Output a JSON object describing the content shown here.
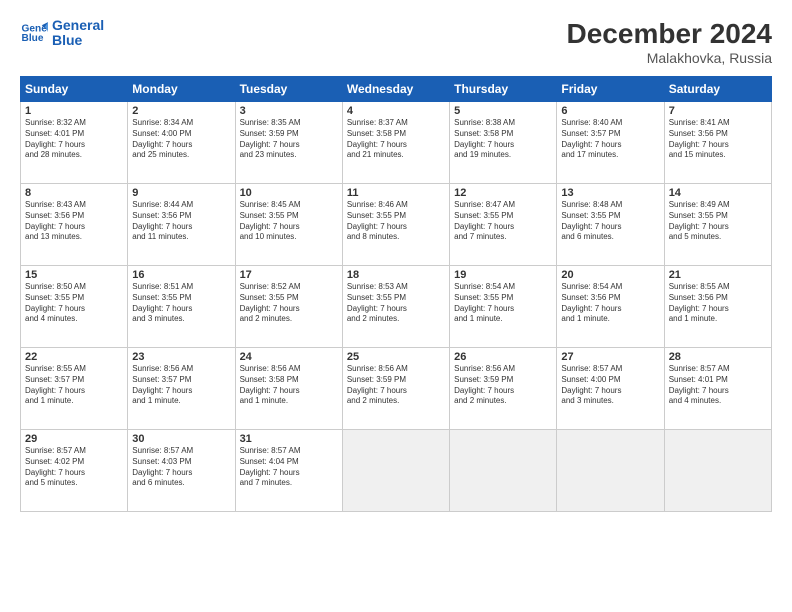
{
  "logo": {
    "line1": "General",
    "line2": "Blue"
  },
  "title": "December 2024",
  "subtitle": "Malakhovka, Russia",
  "days_of_week": [
    "Sunday",
    "Monday",
    "Tuesday",
    "Wednesday",
    "Thursday",
    "Friday",
    "Saturday"
  ],
  "weeks": [
    [
      {
        "day": "1",
        "info": "Sunrise: 8:32 AM\nSunset: 4:01 PM\nDaylight: 7 hours\nand 28 minutes."
      },
      {
        "day": "2",
        "info": "Sunrise: 8:34 AM\nSunset: 4:00 PM\nDaylight: 7 hours\nand 25 minutes."
      },
      {
        "day": "3",
        "info": "Sunrise: 8:35 AM\nSunset: 3:59 PM\nDaylight: 7 hours\nand 23 minutes."
      },
      {
        "day": "4",
        "info": "Sunrise: 8:37 AM\nSunset: 3:58 PM\nDaylight: 7 hours\nand 21 minutes."
      },
      {
        "day": "5",
        "info": "Sunrise: 8:38 AM\nSunset: 3:58 PM\nDaylight: 7 hours\nand 19 minutes."
      },
      {
        "day": "6",
        "info": "Sunrise: 8:40 AM\nSunset: 3:57 PM\nDaylight: 7 hours\nand 17 minutes."
      },
      {
        "day": "7",
        "info": "Sunrise: 8:41 AM\nSunset: 3:56 PM\nDaylight: 7 hours\nand 15 minutes."
      }
    ],
    [
      {
        "day": "8",
        "info": "Sunrise: 8:43 AM\nSunset: 3:56 PM\nDaylight: 7 hours\nand 13 minutes."
      },
      {
        "day": "9",
        "info": "Sunrise: 8:44 AM\nSunset: 3:56 PM\nDaylight: 7 hours\nand 11 minutes."
      },
      {
        "day": "10",
        "info": "Sunrise: 8:45 AM\nSunset: 3:55 PM\nDaylight: 7 hours\nand 10 minutes."
      },
      {
        "day": "11",
        "info": "Sunrise: 8:46 AM\nSunset: 3:55 PM\nDaylight: 7 hours\nand 8 minutes."
      },
      {
        "day": "12",
        "info": "Sunrise: 8:47 AM\nSunset: 3:55 PM\nDaylight: 7 hours\nand 7 minutes."
      },
      {
        "day": "13",
        "info": "Sunrise: 8:48 AM\nSunset: 3:55 PM\nDaylight: 7 hours\nand 6 minutes."
      },
      {
        "day": "14",
        "info": "Sunrise: 8:49 AM\nSunset: 3:55 PM\nDaylight: 7 hours\nand 5 minutes."
      }
    ],
    [
      {
        "day": "15",
        "info": "Sunrise: 8:50 AM\nSunset: 3:55 PM\nDaylight: 7 hours\nand 4 minutes."
      },
      {
        "day": "16",
        "info": "Sunrise: 8:51 AM\nSunset: 3:55 PM\nDaylight: 7 hours\nand 3 minutes."
      },
      {
        "day": "17",
        "info": "Sunrise: 8:52 AM\nSunset: 3:55 PM\nDaylight: 7 hours\nand 2 minutes."
      },
      {
        "day": "18",
        "info": "Sunrise: 8:53 AM\nSunset: 3:55 PM\nDaylight: 7 hours\nand 2 minutes."
      },
      {
        "day": "19",
        "info": "Sunrise: 8:54 AM\nSunset: 3:55 PM\nDaylight: 7 hours\nand 1 minute."
      },
      {
        "day": "20",
        "info": "Sunrise: 8:54 AM\nSunset: 3:56 PM\nDaylight: 7 hours\nand 1 minute."
      },
      {
        "day": "21",
        "info": "Sunrise: 8:55 AM\nSunset: 3:56 PM\nDaylight: 7 hours\nand 1 minute."
      }
    ],
    [
      {
        "day": "22",
        "info": "Sunrise: 8:55 AM\nSunset: 3:57 PM\nDaylight: 7 hours\nand 1 minute."
      },
      {
        "day": "23",
        "info": "Sunrise: 8:56 AM\nSunset: 3:57 PM\nDaylight: 7 hours\nand 1 minute."
      },
      {
        "day": "24",
        "info": "Sunrise: 8:56 AM\nSunset: 3:58 PM\nDaylight: 7 hours\nand 1 minute."
      },
      {
        "day": "25",
        "info": "Sunrise: 8:56 AM\nSunset: 3:59 PM\nDaylight: 7 hours\nand 2 minutes."
      },
      {
        "day": "26",
        "info": "Sunrise: 8:56 AM\nSunset: 3:59 PM\nDaylight: 7 hours\nand 2 minutes."
      },
      {
        "day": "27",
        "info": "Sunrise: 8:57 AM\nSunset: 4:00 PM\nDaylight: 7 hours\nand 3 minutes."
      },
      {
        "day": "28",
        "info": "Sunrise: 8:57 AM\nSunset: 4:01 PM\nDaylight: 7 hours\nand 4 minutes."
      }
    ],
    [
      {
        "day": "29",
        "info": "Sunrise: 8:57 AM\nSunset: 4:02 PM\nDaylight: 7 hours\nand 5 minutes."
      },
      {
        "day": "30",
        "info": "Sunrise: 8:57 AM\nSunset: 4:03 PM\nDaylight: 7 hours\nand 6 minutes."
      },
      {
        "day": "31",
        "info": "Sunrise: 8:57 AM\nSunset: 4:04 PM\nDaylight: 7 hours\nand 7 minutes."
      },
      {
        "day": "",
        "info": ""
      },
      {
        "day": "",
        "info": ""
      },
      {
        "day": "",
        "info": ""
      },
      {
        "day": "",
        "info": ""
      }
    ]
  ]
}
